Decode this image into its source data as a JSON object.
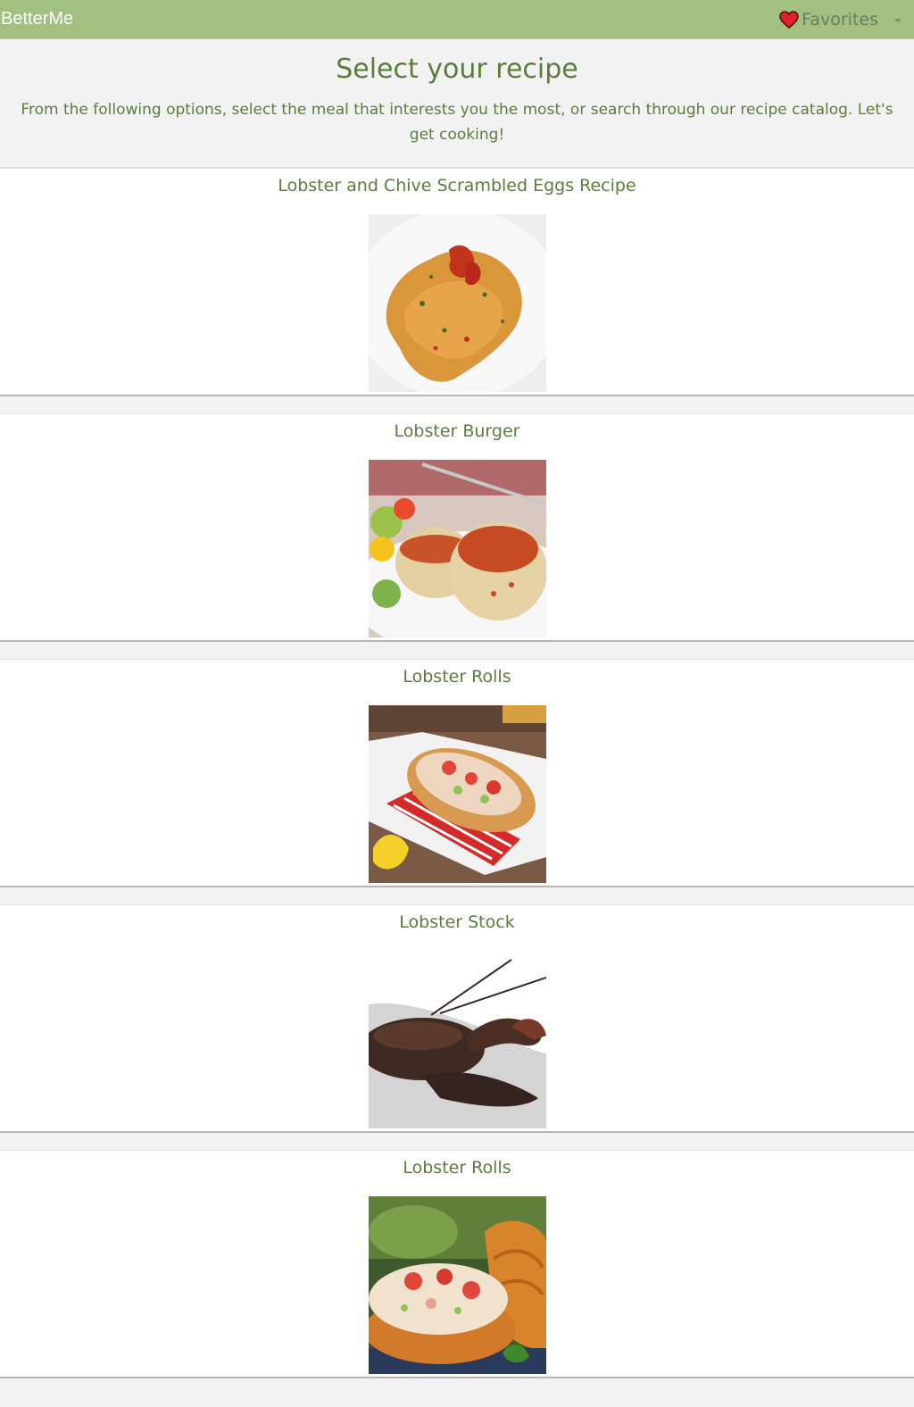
{
  "navbar": {
    "brand": "BetterMe",
    "favorites_label": "Favorites",
    "accent": "#a2c07f"
  },
  "intro": {
    "title": "Select your recipe",
    "description": "From the following options, select the meal that interests you the most, or search through our recipe catalog. Let's get cooking!"
  },
  "recipes": [
    {
      "title": "Lobster and Chive Scrambled Eggs Recipe",
      "image": "scrambled-eggs-photo"
    },
    {
      "title": "Lobster Burger",
      "image": "lobster-cakes-photo"
    },
    {
      "title": "Lobster Rolls",
      "image": "lobster-roll-photo"
    },
    {
      "title": "Lobster Stock",
      "image": "live-lobster-photo"
    },
    {
      "title": "Lobster Rolls",
      "image": "lobster-roll-chips-photo"
    }
  ],
  "colors": {
    "text_green": "#5a7d3c",
    "heart": "#e0202a",
    "page_bg": "#f2f2f2"
  }
}
